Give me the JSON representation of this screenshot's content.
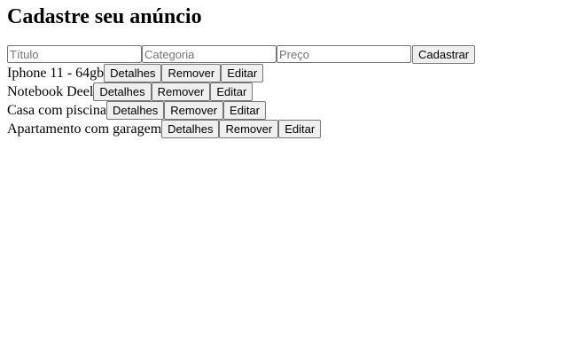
{
  "page": {
    "heading": "Cadastre seu anúncio"
  },
  "form": {
    "titulo_placeholder": "Título",
    "categoria_placeholder": "Categoria",
    "preco_placeholder": "Preço",
    "titulo_value": "",
    "categoria_value": "",
    "preco_value": "",
    "submit_label": "Cadastrar"
  },
  "listings": [
    {
      "title": "Iphone 11 - 64gb",
      "details_label": "Detalhes",
      "remove_label": "Remover",
      "edit_label": "Editar"
    },
    {
      "title": "Notebook Deel",
      "details_label": "Detalhes",
      "remove_label": "Remover",
      "edit_label": "Editar"
    },
    {
      "title": "Casa com piscina",
      "details_label": "Detalhes",
      "remove_label": "Remover",
      "edit_label": "Editar"
    },
    {
      "title": "Apartamento com garagem",
      "details_label": "Detalhes",
      "remove_label": "Remover",
      "edit_label": "Editar"
    }
  ]
}
